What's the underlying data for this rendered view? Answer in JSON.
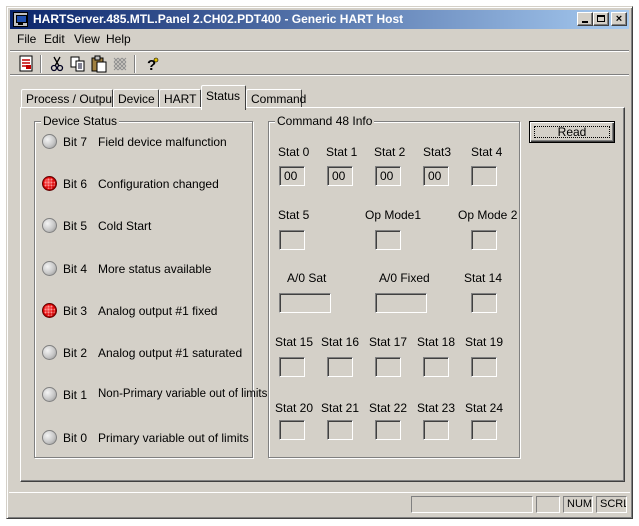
{
  "window": {
    "title": "HARTServer.485.MTL.Panel 2.CH02.PDT400 - Generic HART Host",
    "min_label": "",
    "close_label": "×"
  },
  "menu": [
    "File",
    "Edit",
    "View",
    "Help"
  ],
  "toolbar": {
    "icons": [
      "report-icon",
      "cut-icon",
      "copy-icon",
      "paste-icon",
      "grid-disabled-icon",
      "help-icon"
    ]
  },
  "tabs": [
    "Process / Output",
    "Device",
    "HART",
    "Status",
    "Command"
  ],
  "active_tab": "Status",
  "device_status": {
    "title": "Device Status",
    "bits": [
      {
        "bit": "Bit 7",
        "desc": "Field device malfunction",
        "on": false
      },
      {
        "bit": "Bit 6",
        "desc": "Configuration changed",
        "on": true
      },
      {
        "bit": "Bit 5",
        "desc": "Cold Start",
        "on": false
      },
      {
        "bit": "Bit 4",
        "desc": "More status available",
        "on": false
      },
      {
        "bit": "Bit 3",
        "desc": "Analog output #1 fixed",
        "on": true
      },
      {
        "bit": "Bit 2",
        "desc": "Analog output #1 saturated",
        "on": false
      },
      {
        "bit": "Bit 1",
        "desc": "Non-Primary variable out of limits",
        "on": false
      },
      {
        "bit": "Bit 0",
        "desc": "Primary variable out of limits",
        "on": false
      }
    ]
  },
  "command48": {
    "title": "Command 48 Info",
    "row1": [
      {
        "label": "Stat 0",
        "value": "00"
      },
      {
        "label": "Stat 1",
        "value": "00"
      },
      {
        "label": "Stat 2",
        "value": "00"
      },
      {
        "label": "Stat3",
        "value": "00"
      },
      {
        "label": "Stat 4",
        "value": ""
      }
    ],
    "row2": [
      {
        "label": "Stat 5",
        "value": ""
      },
      {
        "label": "Op Mode1",
        "value": ""
      },
      {
        "label": "Op Mode 2",
        "value": ""
      }
    ],
    "row3": [
      {
        "label": "A/0 Sat",
        "value": ""
      },
      {
        "label": "A/0 Fixed",
        "value": ""
      },
      {
        "label": "Stat 14",
        "value": ""
      }
    ],
    "row4": [
      {
        "label": "Stat 15",
        "value": ""
      },
      {
        "label": "Stat 16",
        "value": ""
      },
      {
        "label": "Stat 17",
        "value": ""
      },
      {
        "label": "Stat 18",
        "value": ""
      },
      {
        "label": "Stat 19",
        "value": ""
      }
    ],
    "row5": [
      {
        "label": "Stat 20",
        "value": ""
      },
      {
        "label": "Stat 21",
        "value": ""
      },
      {
        "label": "Stat 22",
        "value": ""
      },
      {
        "label": "Stat 23",
        "value": ""
      },
      {
        "label": "Stat 24",
        "value": ""
      }
    ]
  },
  "read_button": "Read",
  "statusbar": {
    "pane1": "",
    "pane2": "",
    "num": "NUM",
    "scrl": "SCRL"
  }
}
